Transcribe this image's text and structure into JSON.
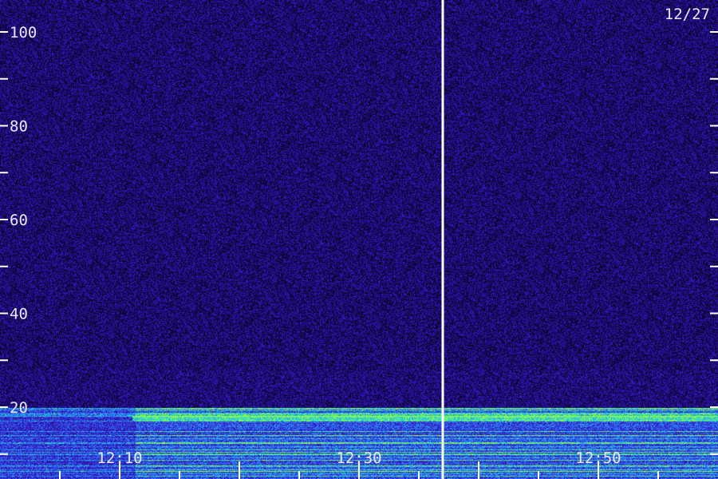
{
  "chart_data": {
    "type": "heatmap",
    "title": "",
    "date": "12/27",
    "xlabel": "",
    "ylabel": "",
    "ylim": [
      0,
      120
    ],
    "y_ticks_major": [
      20,
      40,
      60,
      80,
      100
    ],
    "y_ticks_minor": [
      10,
      30,
      50,
      70,
      90,
      110
    ],
    "xlim_minutes": [
      0,
      60
    ],
    "x_labels": [
      {
        "label": "12:10",
        "minute": 10
      },
      {
        "label": "12:30",
        "minute": 30
      },
      {
        "label": "12:50",
        "minute": 50
      }
    ],
    "x_ticks_minutes": [
      5,
      10,
      15,
      20,
      25,
      30,
      35,
      40,
      45,
      50,
      55
    ],
    "marker_minute": 37,
    "colormap": [
      "#000000",
      "#1a0a6e",
      "#3a17c8",
      "#2a7cff",
      "#22e0d0",
      "#9cff33"
    ],
    "bands": [
      {
        "from": 0,
        "to": 20,
        "description_intensity": "high"
      },
      {
        "from": 20,
        "to": 120,
        "description_intensity": "low"
      }
    ]
  }
}
